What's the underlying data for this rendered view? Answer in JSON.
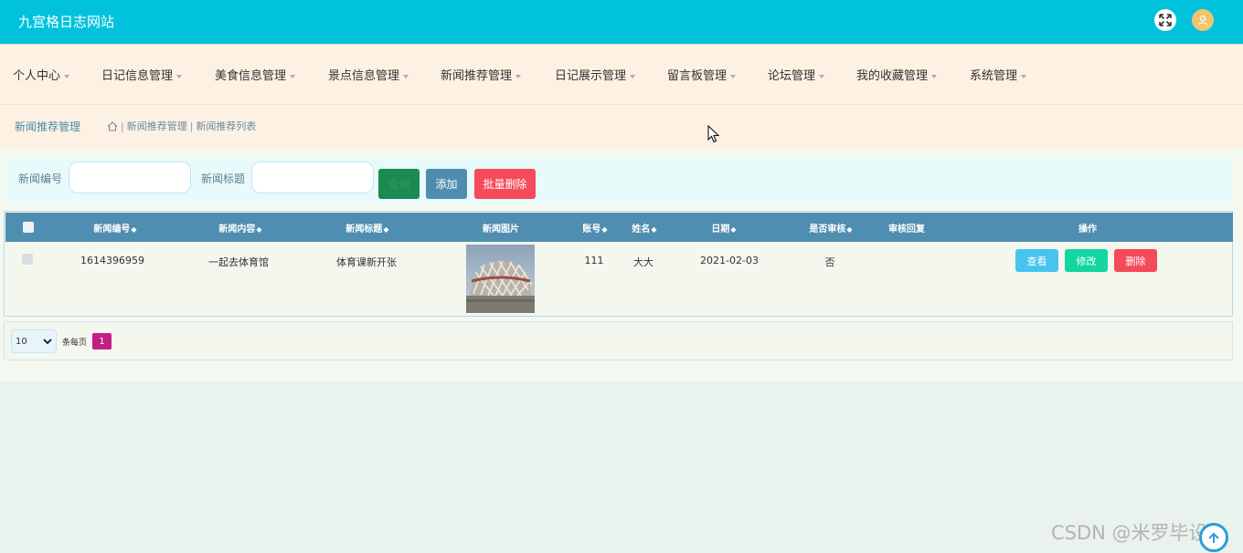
{
  "app": {
    "title": "九宫格日志网站"
  },
  "topbar": {
    "fullscreen_icon": "expand-arrows-icon",
    "avatar_icon": "user-icon",
    "avatar_color": "#f2c46d",
    "bar_color": "#00c2dc"
  },
  "nav": {
    "items": [
      {
        "label": "个人中心"
      },
      {
        "label": "日记信息管理"
      },
      {
        "label": "美食信息管理"
      },
      {
        "label": "景点信息管理"
      },
      {
        "label": "新闻推荐管理"
      },
      {
        "label": "日记展示管理"
      },
      {
        "label": "留言板管理"
      },
      {
        "label": "论坛管理"
      },
      {
        "label": "我的收藏管理"
      },
      {
        "label": "系统管理"
      }
    ]
  },
  "breadcrumb": {
    "page_title": "新闻推荐管理",
    "home_icon": "home-icon",
    "sep": "|",
    "items": [
      "新闻推荐管理",
      "新闻推荐列表"
    ]
  },
  "search": {
    "fields": [
      {
        "label": "新闻编号",
        "value": ""
      },
      {
        "label": "新闻标题",
        "value": ""
      }
    ],
    "buttons": {
      "search": "查询",
      "add": "添加",
      "batch_delete": "批量删除"
    }
  },
  "table": {
    "headers": {
      "news_no": "新闻编号",
      "content": "新闻内容",
      "title": "新闻标题",
      "image": "新闻图片",
      "account": "账号",
      "name": "姓名",
      "date": "日期",
      "is_reviewed": "是否审核",
      "review_reply": "审核回复",
      "actions": "操作"
    },
    "sort_glyph": "◆",
    "rows": [
      {
        "news_no": "1614396959",
        "content": "一起去体育馆",
        "title": "体育课新开张",
        "image": "stadium-photo",
        "account": "111",
        "name": "大大",
        "date": "2021-02-03",
        "is_reviewed": "否",
        "review_reply": "",
        "actions": {
          "view": "查看",
          "edit": "修改",
          "delete": "删除"
        }
      }
    ]
  },
  "pagination": {
    "page_size": "10",
    "page_size_options": [
      "10"
    ],
    "per_page_label": "条每页",
    "current_page": "1"
  },
  "watermark": "CSDN @米罗毕设",
  "colors": {
    "accent": "#4f8eb0",
    "danger": "#f44a5a",
    "success": "#13d6a1",
    "info": "#46c4ee",
    "page_active": "#c41d85"
  }
}
